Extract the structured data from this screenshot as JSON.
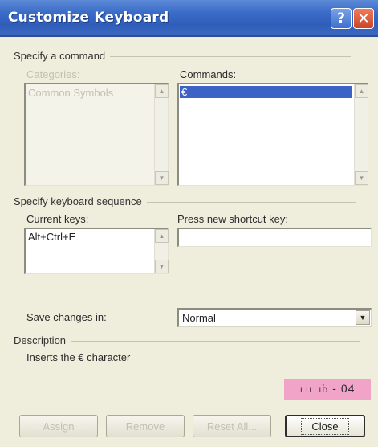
{
  "window": {
    "title": "Customize Keyboard",
    "help_label": "?",
    "close_label": "✕"
  },
  "specify_command": {
    "group_label": "Specify a command",
    "categories_label": "Categories:",
    "categories_items": [
      "Common Symbols"
    ],
    "commands_label": "Commands:",
    "commands_items": [
      "€"
    ]
  },
  "keyboard_sequence": {
    "group_label": "Specify keyboard sequence",
    "current_keys_label": "Current keys:",
    "current_keys_items": [
      "Alt+Ctrl+E"
    ],
    "new_shortcut_label": "Press new shortcut key:",
    "new_shortcut_value": ""
  },
  "save_changes": {
    "label": "Save changes in:",
    "value": "Normal"
  },
  "description": {
    "group_label": "Description",
    "text": "Inserts the € character"
  },
  "badge": {
    "text": "படம் - 04"
  },
  "buttons": {
    "assign": "Assign",
    "remove": "Remove",
    "reset_all": "Reset All...",
    "close": "Close"
  },
  "colors": {
    "titlebar": "#3b6cc8",
    "selection": "#3b62c4",
    "badge": "#f2a3c8"
  }
}
